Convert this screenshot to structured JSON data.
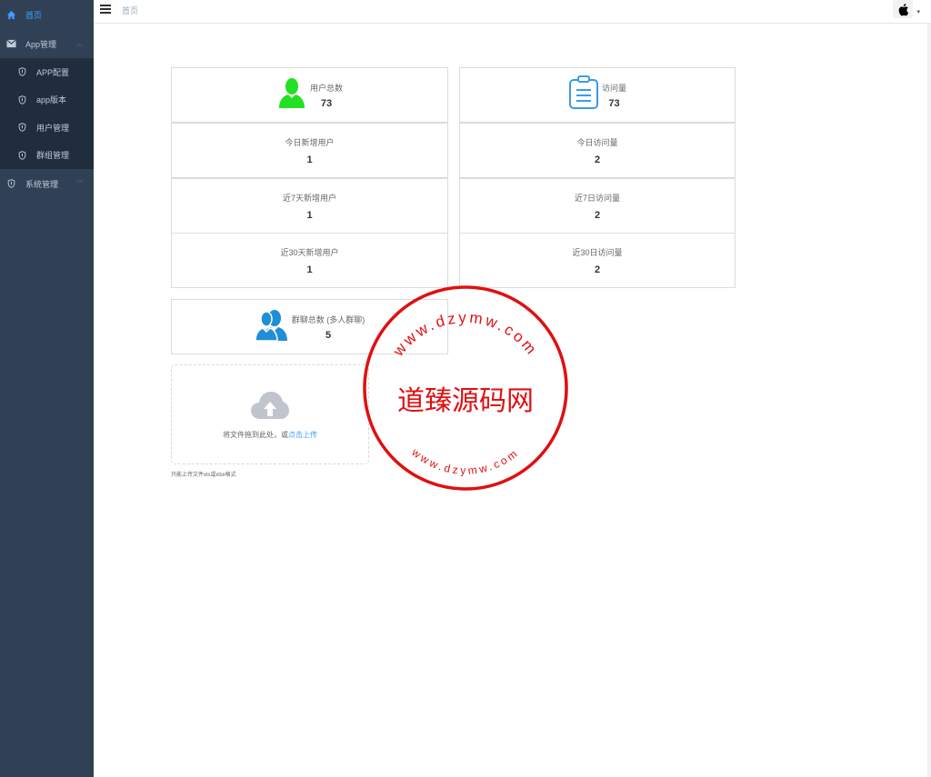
{
  "sidebar": {
    "home": "首页",
    "app_group": "App管理",
    "sub_items": [
      "APP配置",
      "app版本",
      "用户管理",
      "群组管理"
    ],
    "system_group": "系统管理"
  },
  "header": {
    "breadcrumb": "首页"
  },
  "stats": {
    "users_total": {
      "label": "用户总数",
      "value": "73"
    },
    "visits_total": {
      "label": "访问量",
      "value": "73"
    },
    "today_new_users": {
      "label": "今日新增用户",
      "value": "1"
    },
    "today_visits": {
      "label": "今日访问量",
      "value": "2"
    },
    "week_new_users": {
      "label": "近7天新增用户",
      "value": "1"
    },
    "week_visits": {
      "label": "近7日访问量",
      "value": "2"
    },
    "month_new_users": {
      "label": "近30天新增用户",
      "value": "1"
    },
    "month_visits": {
      "label": "近30日访问量",
      "value": "2"
    },
    "groups_total": {
      "label": "群聊总数 (多人群聊)",
      "value": "5"
    }
  },
  "upload": {
    "text": "将文件拖到此处，或",
    "link": "点击上传",
    "tip": "只能上传文件xls或xlsx格式"
  },
  "watermark": {
    "center": "道臻源码网",
    "top_arc": "www.dzymw.com",
    "bottom_arc": "www.dzymw.com"
  },
  "colors": {
    "sidebar_bg": "#304156",
    "submenu_bg": "#1f2d3d",
    "accent": "#409eff",
    "user_icon": "#22e022",
    "group_icon": "#1e8fd6",
    "stamp_red": "#e01010"
  }
}
